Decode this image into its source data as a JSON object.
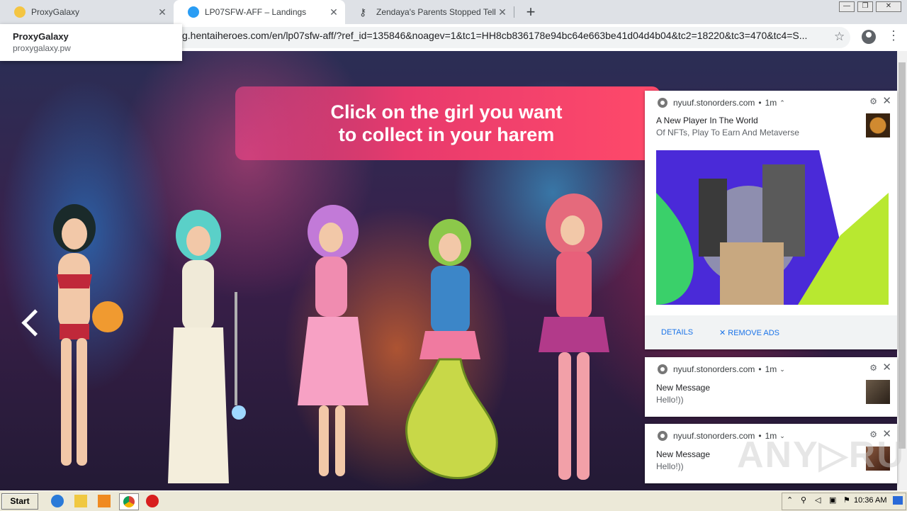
{
  "tabs": [
    {
      "title": "ProxyGalaxy",
      "close": "✕",
      "favicon_color": "#f4c542"
    },
    {
      "title": "LP07SFW-AFF – Landings",
      "close": "✕",
      "favicon_color": "#2a9df4"
    },
    {
      "title": "Zendaya's Parents Stopped Telling H",
      "close": "✕",
      "favicon_color": "#333333"
    }
  ],
  "new_tab": "+",
  "window_buttons": {
    "minimize": "—",
    "maximize": "❐",
    "close": "✕"
  },
  "toolbar": {
    "url": "g.hentaiheroes.com/en/lp07sfw-aff/?ref_id=135846&noagev=1&tc1=HH8cb836178e94bc64e663be41d04d4b04&tc2=18220&tc3=470&tc4=S...",
    "star": "☆",
    "menu": "⋮"
  },
  "dropdown": {
    "title": "ProxyGalaxy",
    "url": "proxygalaxy.pw"
  },
  "page": {
    "banner_line1": "Click on the girl you want",
    "banner_line2": "to collect in your harem",
    "characters": [
      "character-1",
      "character-2",
      "character-3",
      "character-4",
      "character-5"
    ]
  },
  "notifications": [
    {
      "origin": "nyuuf.stonorders.com",
      "time": "1m",
      "title": "A New Player In The World",
      "body": "Of NFTs, Play To Earn And Metaverse",
      "actions": {
        "details": "DETAILS",
        "remove": "✕ REMOVE ADS"
      }
    },
    {
      "origin": "nyuuf.stonorders.com",
      "time": "1m",
      "title": "New Message",
      "body": "Hello!))"
    },
    {
      "origin": "nyuuf.stonorders.com",
      "time": "1m",
      "title": "New Message",
      "body": "Hello!))"
    }
  ],
  "watermark": "ANY▷RUN",
  "taskbar": {
    "start": "Start",
    "clock": "10:36 AM"
  },
  "colors": {
    "banner": "#e83a6d",
    "accent": "#1a73e8",
    "taskbar": "#ece9d8"
  }
}
